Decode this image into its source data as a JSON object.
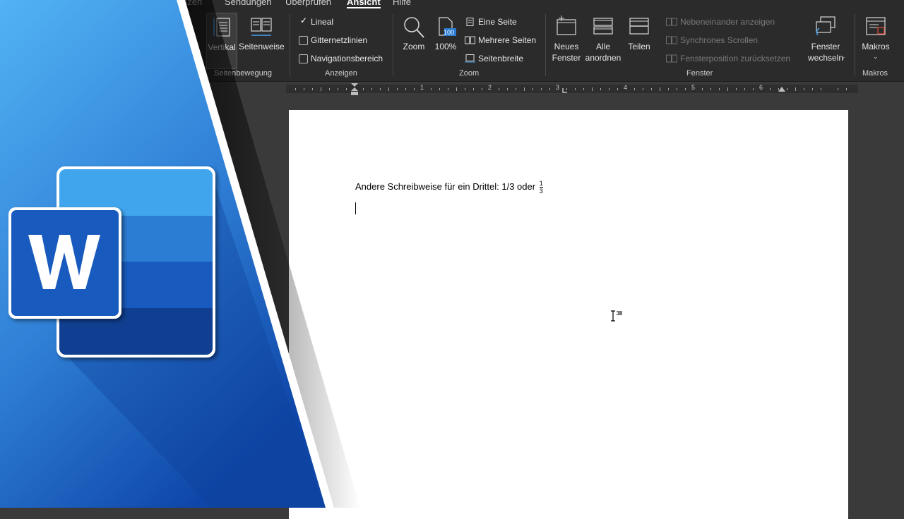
{
  "tabs": [
    {
      "label": "nzen"
    },
    {
      "label": "Sendungen"
    },
    {
      "label": "Überprüfen"
    },
    {
      "label": "Ansicht",
      "active": true
    },
    {
      "label": "Hilfe"
    }
  ],
  "ribbon": {
    "seitenbewegung": {
      "group": "Seitenbewegung",
      "vertikal": "Vertikal",
      "seitenweise": "Seitenweise"
    },
    "anzeigen": {
      "group": "Anzeigen",
      "lineal": {
        "label": "Lineal",
        "checked": true
      },
      "gitternetz": {
        "label": "Gitternetzlinien",
        "checked": false
      },
      "navigation": {
        "label": "Navigationsbereich",
        "checked": false
      }
    },
    "zoom": {
      "group": "Zoom",
      "zoom": "Zoom",
      "pct": "100%",
      "badge": "100",
      "eine_seite": "Eine Seite",
      "mehrere_seiten": "Mehrere Seiten",
      "seitenbreite": "Seitenbreite"
    },
    "fenster": {
      "group": "Fenster",
      "neues_1": "Neues",
      "neues_2": "Fenster",
      "alle_1": "Alle",
      "alle_2": "anordnen",
      "teilen": "Teilen",
      "nebeneinander": "Nebeneinander anzeigen",
      "synchron": "Synchrones Scrollen",
      "position": "Fensterposition zurücksetzen",
      "wechseln_1": "Fenster",
      "wechseln_2": "wechseln"
    },
    "makros": {
      "group": "Makros",
      "label": "Makros"
    }
  },
  "ruler": {
    "numbers": [
      "1",
      "2",
      "3",
      "4",
      "5",
      "6"
    ]
  },
  "document": {
    "line": "Andere Schreibweise für ein Drittel: 1/3 oder",
    "frac_num": "1",
    "frac_den": "3"
  },
  "colors": {
    "accent": "#2b7cd3",
    "ribbon": "#2b2b2b",
    "logo_light": "#41a5ee",
    "logo_dark": "#185abd"
  }
}
